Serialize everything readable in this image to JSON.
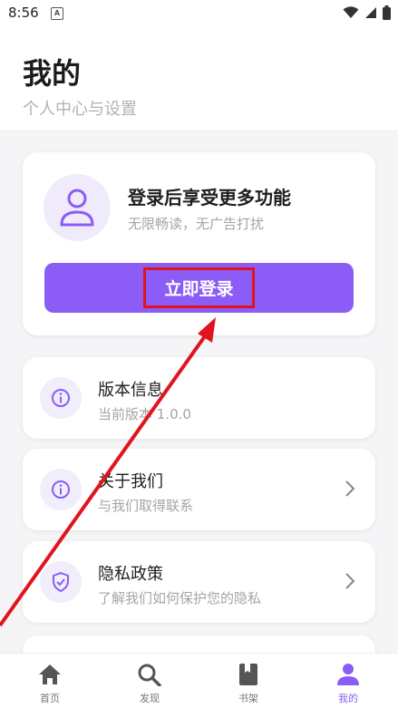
{
  "status_bar": {
    "time": "8:56",
    "notification_letter": "A"
  },
  "header": {
    "title": "我的",
    "subtitle": "个人中心与设置"
  },
  "login_card": {
    "title": "登录后享受更多功能",
    "subtitle": "无限畅读，无广告打扰",
    "button_label": "立即登录"
  },
  "menu": [
    {
      "title": "版本信息",
      "subtitle": "当前版本 1.0.0",
      "icon": "info-icon",
      "has_chevron": false
    },
    {
      "title": "关于我们",
      "subtitle": "与我们取得联系",
      "icon": "info-icon",
      "has_chevron": true
    },
    {
      "title": "隐私政策",
      "subtitle": "了解我们如何保护您的隐私",
      "icon": "shield-icon",
      "has_chevron": true
    }
  ],
  "bottom_nav": [
    {
      "label": "首页",
      "icon": "home-icon",
      "active": false
    },
    {
      "label": "发现",
      "icon": "search-icon",
      "active": false
    },
    {
      "label": "书架",
      "icon": "book-icon",
      "active": false
    },
    {
      "label": "我的",
      "icon": "person-icon",
      "active": true
    }
  ],
  "colors": {
    "accent": "#8b5cf6",
    "highlight": "#e0141e",
    "icon_bg": "#f1eefc"
  }
}
